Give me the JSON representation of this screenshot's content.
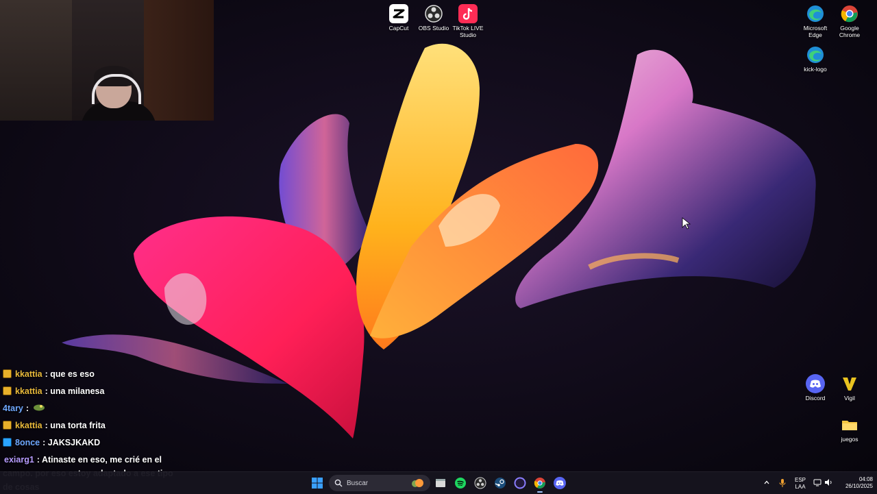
{
  "desktop": {
    "icons_top": [
      {
        "label": "CapCut",
        "icon": "capcut-icon"
      },
      {
        "label": "OBS Studio",
        "icon": "obs-studio-icon"
      },
      {
        "label": "TikTok LIVE Studio",
        "icon": "tiktok-live-studio-icon"
      }
    ],
    "icons_right": [
      {
        "label": "Microsoft Edge",
        "icon": "edge-icon"
      },
      {
        "label": "Google Chrome",
        "icon": "chrome-icon"
      },
      {
        "label": "kick-logo",
        "icon": "edge-icon"
      },
      {
        "label": "Discord",
        "icon": "discord-icon"
      },
      {
        "label": "Vigil",
        "icon": "vigil-icon"
      },
      {
        "label": "juegos",
        "icon": "folder-icon"
      }
    ]
  },
  "chat": {
    "messages": [
      {
        "user": "kkattia",
        "text": ": que es eso",
        "badge": "sub",
        "user_color": "#e8b93a"
      },
      {
        "user": "kkattia",
        "text": ": una milanesa",
        "badge": "sub",
        "user_color": "#e8b93a"
      },
      {
        "user": "4tary",
        "text": ":",
        "badge": "",
        "user_color": "#6fa8ff"
      },
      {
        "user": "kkattia",
        "text": ": una torta frita",
        "badge": "sub",
        "user_color": "#e8b93a"
      },
      {
        "user": "8once",
        "text": ": JAKSJKAKD",
        "badge": "vip",
        "user_color": "#6fa8ff"
      },
      {
        "user": "exiarg1",
        "text": ": Atinaste en eso, me crié en el campo. por eso estoy adaptado a ese tipo de cosas",
        "badge": "",
        "user_color": "#b79cff"
      }
    ]
  },
  "taskbar": {
    "search_placeholder": "Buscar",
    "apps": [
      "start-icon",
      "file-explorer-icon",
      "spotify-icon",
      "obs-studio-icon",
      "steam-icon",
      "app-circle-icon",
      "chrome-icon",
      "discord-icon"
    ],
    "lang_top": "ESP",
    "lang_bottom": "LAA",
    "time": "04:08",
    "date": "26/10/2025"
  },
  "colors": {
    "taskbar_bg": "#16141e",
    "accent": "#9fc6ff"
  }
}
